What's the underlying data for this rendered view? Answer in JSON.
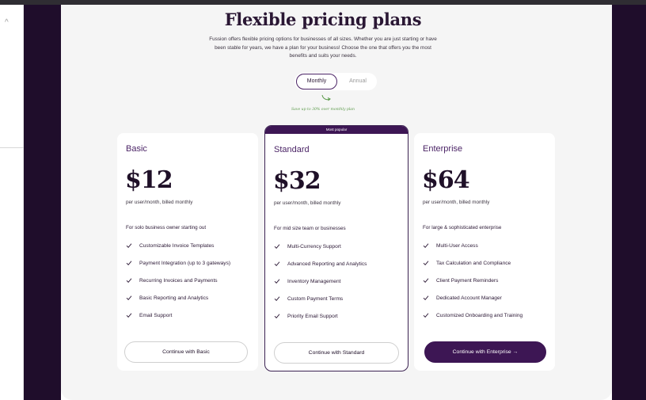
{
  "header": {
    "title": "Flexible pricing plans",
    "subtitle_lines": [
      "Fussion offers flexible pricing options for businesses of all sizes. Whether you are just starting or have",
      "been stable for years, we have a plan for your business! Choose the one that offers you the most",
      "benefits and suits your needs."
    ]
  },
  "billing_toggle": {
    "monthly_label": "Monthly",
    "annual_label": "Annual",
    "selected": "Monthly",
    "save_note": "Save up to 30% over monthly plan"
  },
  "plans": [
    {
      "name": "Basic",
      "price": "$12",
      "billing": "per user/month, billed monthly",
      "audience": "For solo business owner starting out",
      "features": [
        "Customizable Invoice Templates",
        "Payment Integration (up to 3 gateways)",
        "Recurring Invoices and Payments",
        "Basic Reporting and Analytics",
        "Email Support"
      ],
      "cta": "Continue with Basic"
    },
    {
      "name": "Standard",
      "badge": "Most popular",
      "price": "$32",
      "billing": "per user/month, billed monthly",
      "audience": "For mid size team or businesses",
      "features": [
        "Multi-Currency Support",
        "Advanced Reporting and Analytics",
        "Inventory Management",
        "Custom Payment Terms",
        "Priority Email Support"
      ],
      "cta": "Continue with Standard"
    },
    {
      "name": "Enterprise",
      "price": "$64",
      "billing": "per user/month, billed monthly",
      "audience": "For large & sophisticated enterprise",
      "features": [
        "Multi-User Access",
        "Tax Calculation and Compliance",
        "Client Payment Reminders",
        "Dedicated Account Manager",
        "Customized Onboarding and Training"
      ],
      "cta": "Continue with Enterprise →"
    }
  ],
  "icons": {
    "check": "check-icon",
    "gutter": "chevron-up-icon",
    "doodle": "curved-arrow-icon"
  },
  "colors": {
    "brand_dark": "#3d1654",
    "brand_text": "#4b2466",
    "page_frame": "#1f0d2b",
    "panel_bg": "#f5f5f5",
    "note_green": "#5b9a4a"
  }
}
